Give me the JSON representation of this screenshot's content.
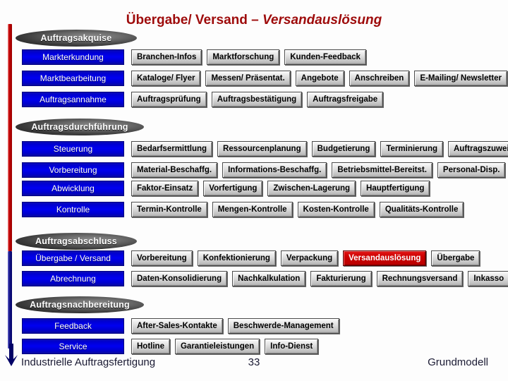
{
  "title": {
    "plain": "Übergabe/ Versand – ",
    "italic": "Versandauslösung"
  },
  "colors": {
    "title": "#9e0b0b",
    "highlight": "#cc0000",
    "blue_button": "#0000f0",
    "arrow_top": "#c00000",
    "arrow_bottom": "#000066"
  },
  "phases": [
    {
      "header": "Auftragsakquise",
      "rows": [
        {
          "label": "Markterkundung",
          "items": [
            "Branchen-Infos",
            "Marktforschung",
            "Kunden-Feedback"
          ]
        },
        {
          "label": "Marktbearbeitung",
          "items": [
            "Kataloge/ Flyer",
            "Messen/ Präsentat.",
            "Angebote",
            "Anschreiben",
            "E-Mailing/ Newsletter"
          ]
        },
        {
          "label": "Auftragsannahme",
          "items": [
            "Auftragsprüfung",
            "Auftragsbestätigung",
            "Auftragsfreigabe"
          ]
        }
      ]
    },
    {
      "header": "Auftragsdurchführung",
      "rows": [
        {
          "label": "Steuerung",
          "items": [
            "Bedarfsermittlung",
            "Ressourcenplanung",
            "Budgetierung",
            "Terminierung",
            "Auftragszuweisung"
          ]
        },
        {
          "label": "Vorbereitung",
          "items": [
            "Material-Beschaffg.",
            "Informations-Beschaffg.",
            "Betriebsmittel-Bereitst.",
            "Personal-Disp."
          ]
        },
        {
          "label": "Abwicklung",
          "items": [
            "Faktor-Einsatz",
            "Vorfertigung",
            "Zwischen-Lagerung",
            "Hauptfertigung"
          ]
        },
        {
          "label": "Kontrolle",
          "items": [
            "Termin-Kontrolle",
            "Mengen-Kontrolle",
            "Kosten-Kontrolle",
            "Qualitäts-Kontrolle"
          ]
        }
      ]
    },
    {
      "header": "Auftragsabschluss",
      "rows": [
        {
          "label": "Übergabe / Versand",
          "items": [
            "Vorbereitung",
            "Konfektionierung",
            "Verpackung",
            "Versandauslösung",
            "Übergabe"
          ],
          "highlight": "Versandauslösung"
        },
        {
          "label": "Abrechnung",
          "items": [
            "Daten-Konsolidierung",
            "Nachkalkulation",
            "Fakturierung",
            "Rechnungsversand",
            "Inkasso"
          ]
        }
      ]
    },
    {
      "header": "Auftragsnachbereitung",
      "rows": [
        {
          "label": "Feedback",
          "items": [
            "After-Sales-Kontakte",
            "Beschwerde-Management"
          ]
        },
        {
          "label": "Service",
          "items": [
            "Hotline",
            "Garantieleistungen",
            "Info-Dienst"
          ]
        }
      ]
    }
  ],
  "footer": {
    "left": "Industrielle Auftragsfertigung",
    "center": "33",
    "right": "Grundmodell"
  }
}
